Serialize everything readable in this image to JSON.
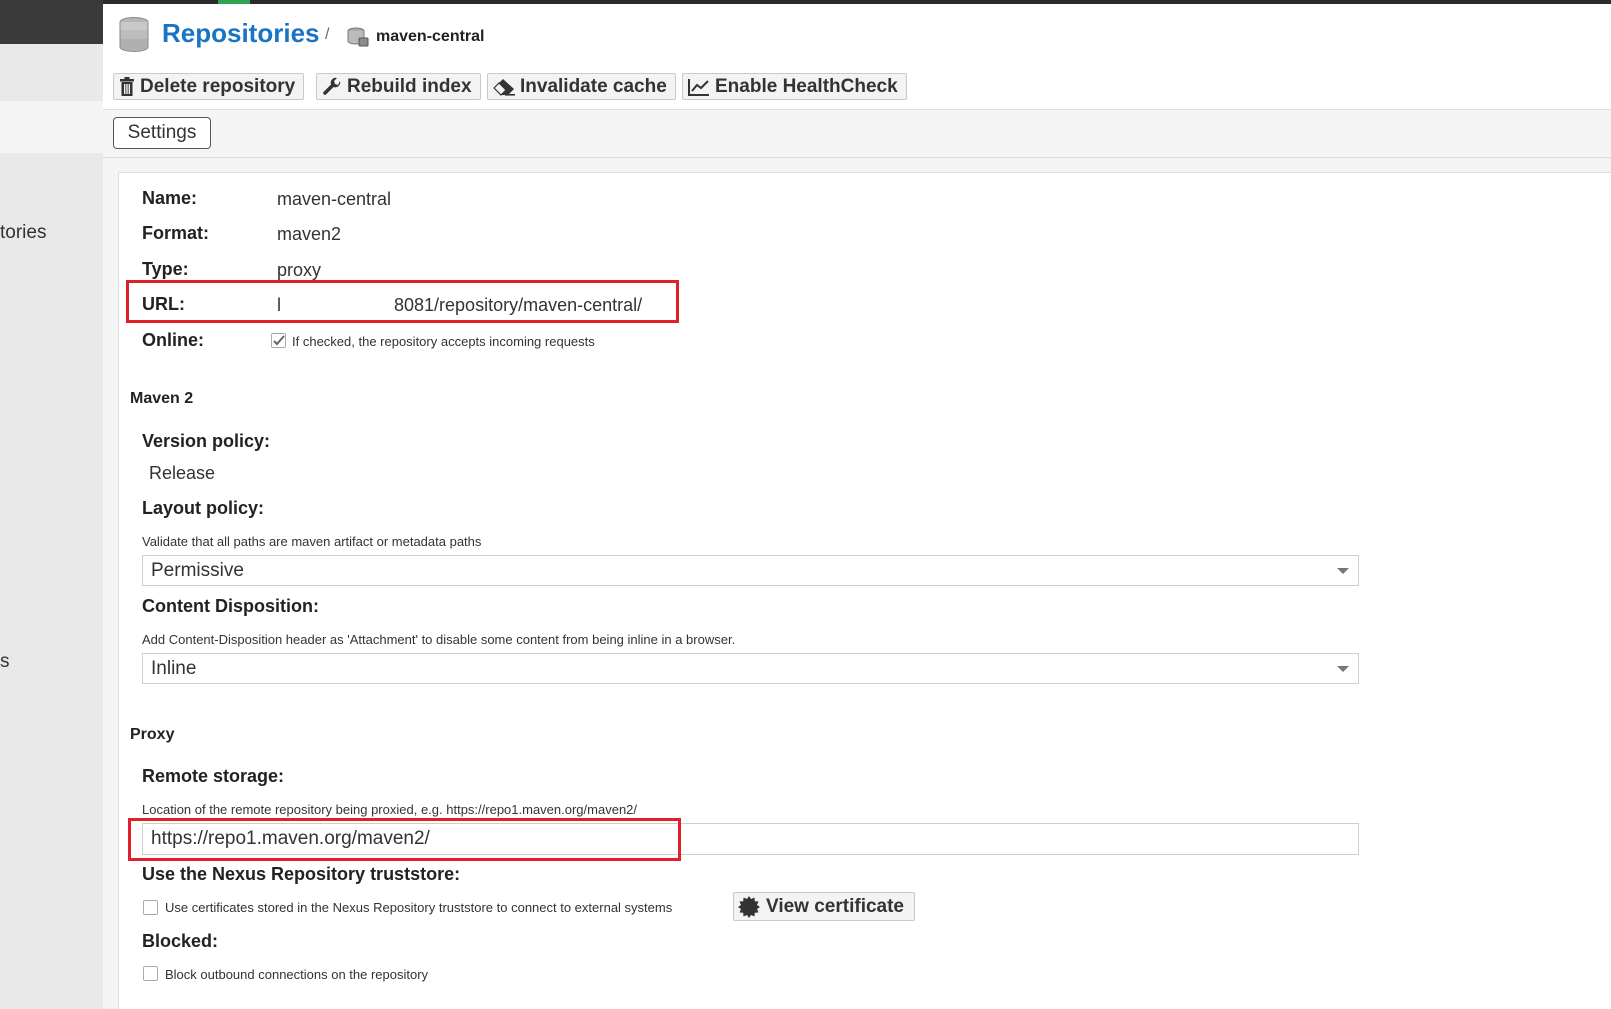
{
  "sidebar": {
    "items": [
      {
        "label": "tories"
      },
      {
        "label": "s"
      }
    ]
  },
  "header": {
    "title": "Repositories",
    "separator": "/",
    "breadcrumb": "maven-central"
  },
  "toolbar": {
    "delete_label": "Delete repository",
    "rebuild_label": "Rebuild index",
    "invalidate_label": "Invalidate cache",
    "healthcheck_label": "Enable HealthCheck"
  },
  "tabs": {
    "settings_label": "Settings"
  },
  "details": {
    "name_label": "Name:",
    "name_value": "maven-central",
    "format_label": "Format:",
    "format_value": "maven2",
    "type_label": "Type:",
    "type_value": "proxy",
    "url_label": "URL:",
    "url_prefix": "l",
    "url_value": "8081/repository/maven-central/",
    "online_label": "Online:",
    "online_checked": true,
    "online_help": "If checked, the repository accepts incoming requests"
  },
  "maven": {
    "section_title": "Maven 2",
    "version_policy_label": "Version policy:",
    "version_policy_value": "Release",
    "layout_policy_label": "Layout policy:",
    "layout_policy_help": "Validate that all paths are maven artifact or metadata paths",
    "layout_policy_value": "Permissive",
    "content_disposition_label": "Content Disposition:",
    "content_disposition_help": "Add Content-Disposition header as 'Attachment' to disable some content from being inline in a browser.",
    "content_disposition_value": "Inline"
  },
  "proxy": {
    "section_title": "Proxy",
    "remote_storage_label": "Remote storage:",
    "remote_storage_help": "Location of the remote repository being proxied, e.g. https://repo1.maven.org/maven2/",
    "remote_storage_value": "https://repo1.maven.org/maven2/",
    "truststore_label": "Use the Nexus Repository truststore:",
    "truststore_help": "Use certificates stored in the Nexus Repository truststore to connect to external systems",
    "truststore_checked": false,
    "view_certificate_label": "View certificate",
    "blocked_label": "Blocked:",
    "blocked_help": "Block outbound connections on the repository",
    "blocked_checked": false
  },
  "colors": {
    "accent": "#1975c4",
    "highlight": "#e0202a",
    "nav_green": "#2fa34d"
  }
}
